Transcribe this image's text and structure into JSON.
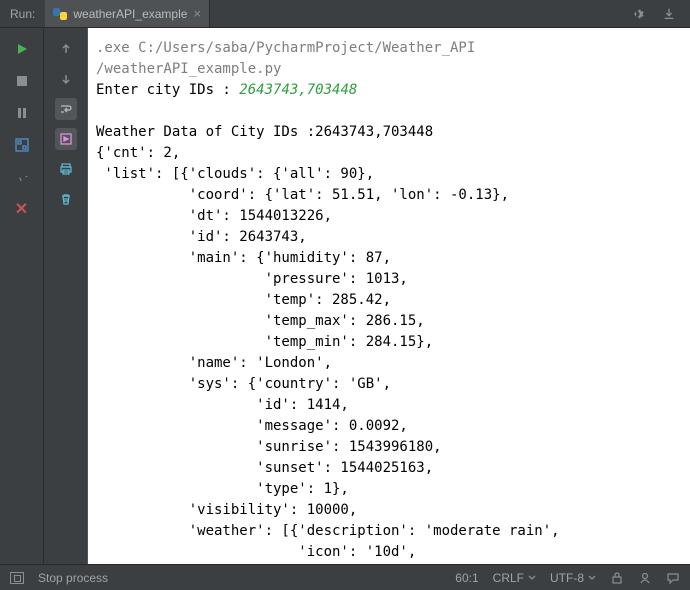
{
  "topbar": {
    "run_label": "Run:",
    "tab_label": "weatherAPI_example"
  },
  "console": {
    "path_line1": ".exe C:/Users/saba/PycharmProject/Weather_API",
    "path_line2": "/weatherAPI_example.py",
    "prompt_text": "Enter city IDs : ",
    "prompt_value": "2643743,703448",
    "output": "Weather Data of City IDs :2643743,703448\n{'cnt': 2,\n 'list': [{'clouds': {'all': 90},\n           'coord': {'lat': 51.51, 'lon': -0.13},\n           'dt': 1544013226,\n           'id': 2643743,\n           'main': {'humidity': 87,\n                    'pressure': 1013,\n                    'temp': 285.42,\n                    'temp_max': 286.15,\n                    'temp_min': 284.15},\n           'name': 'London',\n           'sys': {'country': 'GB',\n                   'id': 1414,\n                   'message': 0.0092,\n                   'sunrise': 1543996180,\n                   'sunset': 1544025163,\n                   'type': 1},\n           'visibility': 10000,\n           'weather': [{'description': 'moderate rain',\n                        'icon': '10d',"
  },
  "status": {
    "left": "Stop process",
    "pos": "60:1",
    "sep": "CRLF",
    "enc": "UTF-8"
  }
}
